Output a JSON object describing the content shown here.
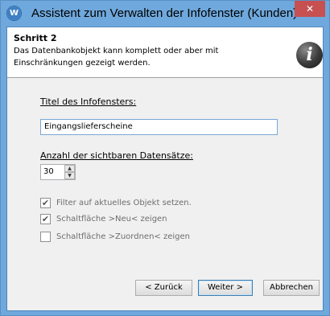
{
  "window": {
    "app_icon_glyph": "W",
    "title": "Assistent zum Verwalten der Infofenster (Kunden)",
    "close_glyph": "✕"
  },
  "header": {
    "step": "Schritt 2",
    "description": "Das Datenbankobjekt kann komplett oder aber mit Einschränkungen gezeigt werden.",
    "info_glyph": "i"
  },
  "form": {
    "title_label": "Titel des Infofensters:",
    "title_value": "Eingangslieferscheine",
    "count_label": "Anzahl der sichtbaren Datensätze:",
    "count_value": "30",
    "options": [
      {
        "label": "Filter auf aktuelles Objekt setzen.",
        "checked": true,
        "mark": "✔"
      },
      {
        "label": "Schaltfläche >Neu< zeigen",
        "checked": true,
        "mark": "✔"
      },
      {
        "label": "Schaltfläche >Zuordnen< zeigen",
        "checked": false,
        "mark": ""
      }
    ]
  },
  "buttons": {
    "back": "< Zurück",
    "next": "Weiter >",
    "cancel": "Abbrechen"
  }
}
